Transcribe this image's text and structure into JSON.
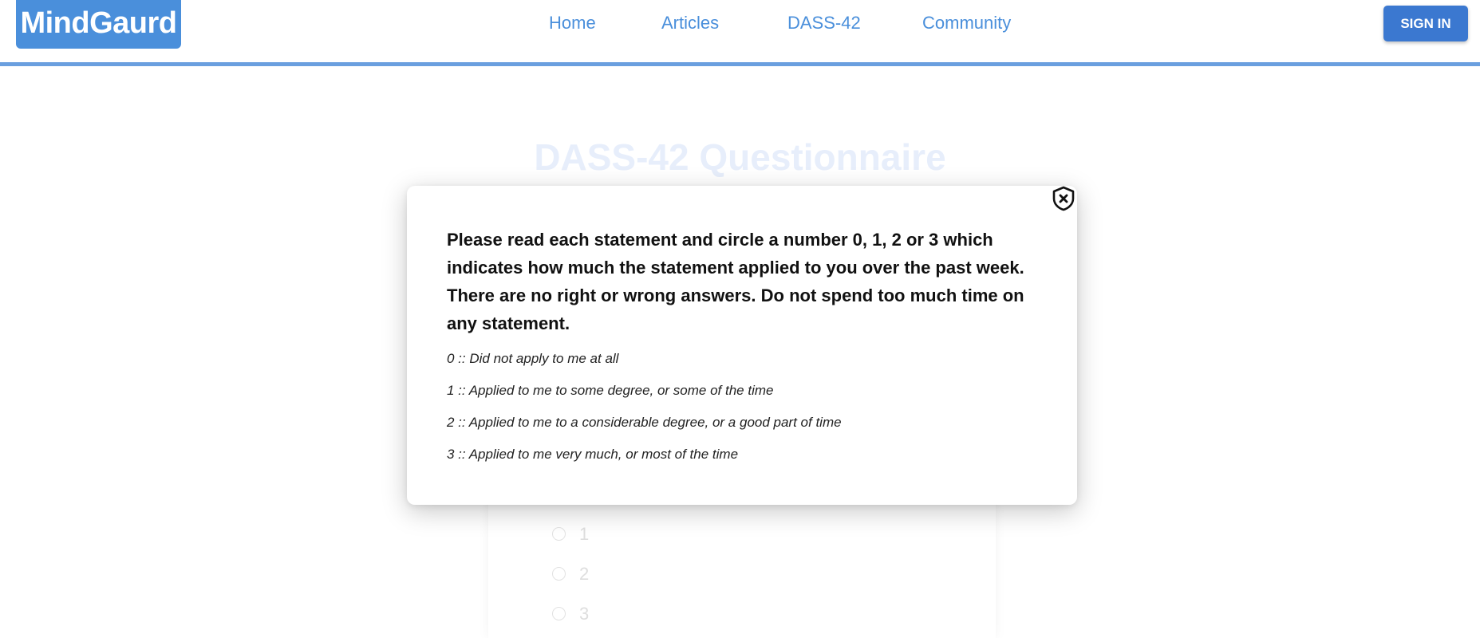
{
  "header": {
    "logo": "MindGaurd",
    "nav": [
      "Home",
      "Articles",
      "DASS-42",
      "Community"
    ],
    "signin_label": "SIGN IN"
  },
  "page": {
    "title": "DASS-42 Questionnaire",
    "visible_options": [
      "1",
      "2",
      "3"
    ]
  },
  "modal": {
    "close_icon": "shield-x-icon",
    "heading": "Please read each statement and circle a number 0, 1, 2 or 3 which indicates how much the statement applied to you over the past week. There are no right or wrong answers. Do not spend too much time on any statement.",
    "scale": [
      "0 :: Did not apply to me at all",
      "1 :: Applied to me to some degree, or some of the time",
      "2 :: Applied to me to a considerable degree, or a good part of time",
      "3 :: Applied to me very much, or most of the time"
    ]
  },
  "colors": {
    "brand": "#4a8fdb",
    "signin": "#3b78d0",
    "nav_border": "#6a9fdf"
  }
}
